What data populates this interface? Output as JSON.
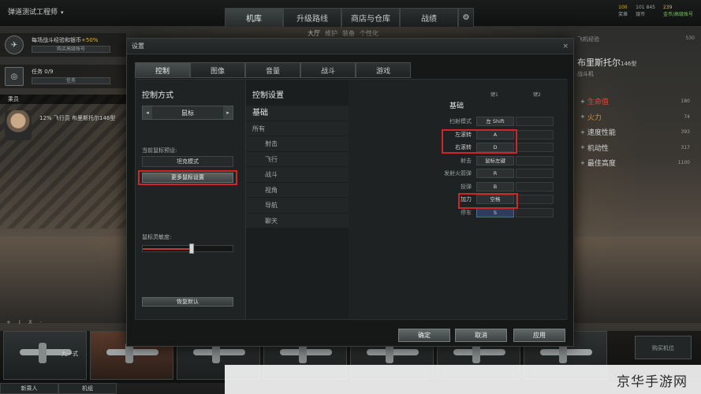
{
  "topbar": {
    "player_name": "弹道测试工程师",
    "nav": [
      "机库",
      "升级路线",
      "商店与仓库",
      "战绩"
    ],
    "subnav": [
      "大厅",
      "维护",
      "装备",
      "个性化"
    ],
    "currency": [
      "100",
      "101 845",
      "239"
    ],
    "currency_sub": [
      "奖章",
      "银币",
      "金币/高级账号"
    ]
  },
  "left_panel": {
    "bonus_line": "每场战斗经验和银币",
    "bonus_pct": "+50%",
    "bonus_sub": "购买高级账号",
    "task_label": "任务",
    "task_count": "0/9",
    "task_sub": "任务",
    "crew_tab": "乘员",
    "pilot_line": "12%  飞行员 布里斯托尔146型"
  },
  "right_panel": {
    "xp_label": "飞机经验",
    "xp_value": "530",
    "plane_name": "布里斯托尔",
    "plane_model": "146型",
    "plane_type": "战斗机",
    "stats": [
      {
        "label": "生命值",
        "value": "180"
      },
      {
        "label": "火力",
        "value": "74"
      },
      {
        "label": "速度性能",
        "value": "393"
      },
      {
        "label": "机动性",
        "value": "317"
      },
      {
        "label": "最佳高度",
        "value": "1100"
      }
    ]
  },
  "bottom": {
    "filters": [
      "+",
      "I",
      "X",
      "·"
    ],
    "slot_label": "九一式",
    "buy_slot": "购买机位",
    "tabs": [
      "新乘人",
      "机组"
    ]
  },
  "dialog": {
    "title": "设置",
    "close": "×",
    "tabs": [
      "控制",
      "图像",
      "音量",
      "战斗",
      "游戏"
    ],
    "control_method_title": "控制方式",
    "mouse_value": "鼠标",
    "arrow_left": "◂",
    "arrow_right": "▸",
    "preset_label": "当前鼠标预设:",
    "preset_value": "坦克模式",
    "more_mouse_settings": "更多鼠标设置",
    "sensitivity_label": "鼠标灵敏度:",
    "sensitivity": 0.54,
    "restore_default": "恢复默认",
    "control_settings_title": "控制设置",
    "categories": [
      {
        "label": "基础",
        "kind": "head"
      },
      {
        "label": "所有",
        "kind": "plain"
      },
      {
        "label": "射击",
        "kind": "sub"
      },
      {
        "label": "飞行",
        "kind": "sub"
      },
      {
        "label": "战斗",
        "kind": "sub"
      },
      {
        "label": "视角",
        "kind": "sub"
      },
      {
        "label": "导航",
        "kind": "sub"
      },
      {
        "label": "聊天",
        "kind": "sub"
      }
    ],
    "key1_header": "键1",
    "key2_header": "键2",
    "section_title": "基础",
    "bindings": [
      {
        "action": "扫射模式",
        "key": "左 Shift"
      },
      {
        "action": "左滚转",
        "key": "A"
      },
      {
        "action": "右滚转",
        "key": "D"
      },
      {
        "action": "射击",
        "key": "鼠标左键"
      },
      {
        "action": "发射火箭弹",
        "key": "R"
      },
      {
        "action": "投弹",
        "key": "B"
      },
      {
        "action": "加力",
        "key": "空格"
      },
      {
        "action": "停车",
        "key": "S"
      }
    ],
    "ok": "确定",
    "cancel": "取消",
    "apply": "应用"
  },
  "watermark": "京华手游网"
}
